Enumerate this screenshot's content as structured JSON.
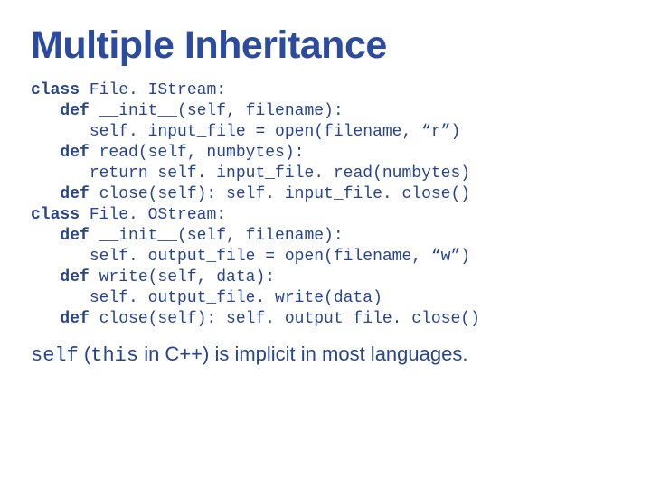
{
  "title": "Multiple Inheritance",
  "code": {
    "l1": {
      "kw": "class",
      "rest": " File. IStream:"
    },
    "l2": {
      "kw": "def",
      "rest": " __init__(self, filename):"
    },
    "l3": "self. input_file = open(filename, “r”)",
    "l4": {
      "kw": "def",
      "rest": " read(self, numbytes):"
    },
    "l5": "return self. input_file. read(numbytes)",
    "l6": {
      "kw": "def",
      "rest": " close(self): self. input_file. close()"
    },
    "l7": {
      "kw": "class",
      "rest": " File. OStream:"
    },
    "l8": {
      "kw": "def",
      "rest": " __init__(self, filename):"
    },
    "l9": "self. output_file = open(filename, “w”)",
    "l10": {
      "kw": "def",
      "rest": " write(self, data):"
    },
    "l11": "self. output_file. write(data)",
    "l12": {
      "kw": "def",
      "rest": " close(self): self. output_file. close()"
    }
  },
  "caption": {
    "p1": "self",
    "p2": " (",
    "p3": "this",
    "p4": " in C++) is implicit in most languages."
  }
}
